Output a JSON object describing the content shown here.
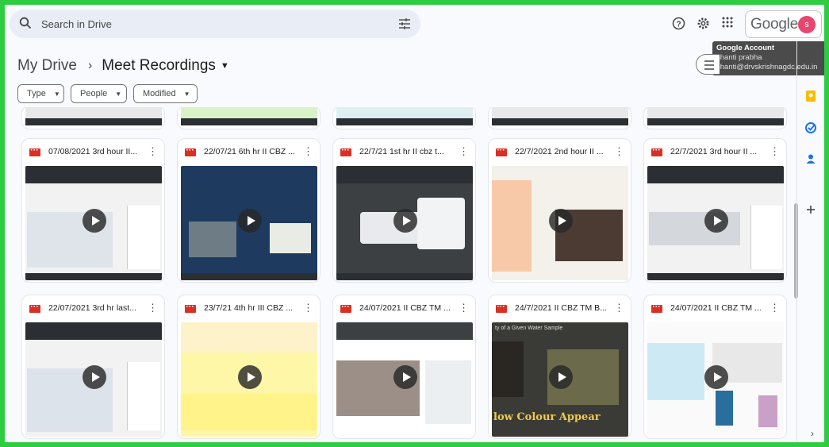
{
  "search": {
    "placeholder": "Search in Drive"
  },
  "account": {
    "logo_text": "Google",
    "avatar_letter": "s",
    "tooltip_title": "Google Account",
    "tooltip_name": "shanti prabha",
    "tooltip_email": "shanti@drvskrishnagdc.edu.in"
  },
  "breadcrumb": {
    "root": "My Drive",
    "current": "Meet Recordings"
  },
  "filters": {
    "type": "Type",
    "people": "People",
    "modified": "Modified"
  },
  "files_row1": [
    {
      "title": "07/08/2021 3rd hour II..."
    },
    {
      "title": "22/07/21 6th hr II CBZ ..."
    },
    {
      "title": "22/7/21 1st hr II cbz t..."
    },
    {
      "title": "22/7/2021 2nd hour II ..."
    },
    {
      "title": "22/7/2021 3rd hour II ..."
    }
  ],
  "files_row2": [
    {
      "title": "22/07/2021 3rd hr last..."
    },
    {
      "title": "23/7/21 4th hr III CBZ ..."
    },
    {
      "title": "24/07/2021 II CBZ TM ..."
    },
    {
      "title": "24/7/2021 II CBZ TM B..."
    },
    {
      "title": "24/07/2021 II CBZ TM ..."
    }
  ],
  "thumbnail_text": {
    "yellow_caption": "low Colour Appear",
    "lab_caption": "ty of a Given Water Sample"
  },
  "colors": {
    "video_icon": "#d93025",
    "accent": "#0b57d0",
    "frame": "#2ecc40"
  }
}
